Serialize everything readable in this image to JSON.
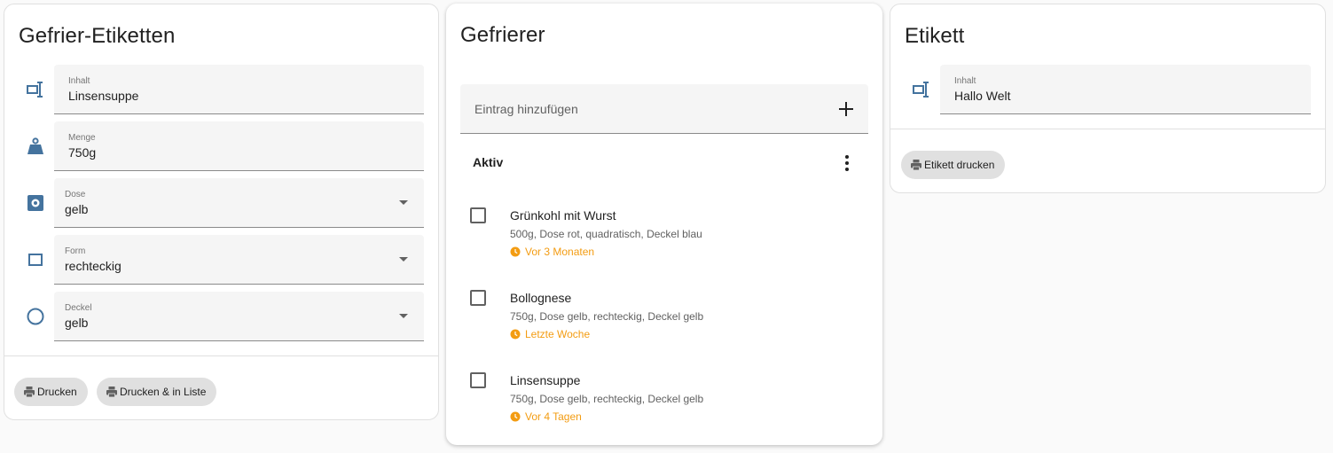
{
  "labels_card": {
    "title": "Gefrier-Etiketten",
    "fields": [
      {
        "label": "Inhalt",
        "value": "Linsensuppe",
        "icon": "label-icon"
      },
      {
        "label": "Menge",
        "value": "750g",
        "icon": "weight-icon"
      },
      {
        "label": "Dose",
        "value": "gelb",
        "icon": "box-icon"
      },
      {
        "label": "Form",
        "value": "rechteckig",
        "icon": "rectangle-icon"
      },
      {
        "label": "Deckel",
        "value": "gelb",
        "icon": "circle-icon"
      }
    ],
    "buttons": {
      "print": "Drucken",
      "print_and_list": "Drucken & in Liste"
    }
  },
  "freezer_card": {
    "title": "Gefrierer",
    "add_placeholder": "Eintrag hinzufügen",
    "section_title": "Aktiv",
    "items": [
      {
        "title": "Grünkohl mit Wurst",
        "details": "500g, Dose rot, quadratisch, Deckel blau",
        "time": "Vor 3 Monaten",
        "checked": false
      },
      {
        "title": "Bollognese",
        "details": "750g, Dose gelb, rechteckig, Deckel gelb",
        "time": "Letzte Woche",
        "checked": false
      },
      {
        "title": "Linsensuppe",
        "details": "750g, Dose gelb, rechteckig, Deckel gelb",
        "time": "Vor 4 Tagen",
        "checked": false
      }
    ]
  },
  "label_card": {
    "title": "Etikett",
    "field": {
      "label": "Inhalt",
      "value": "Hallo Welt",
      "icon": "label-icon"
    },
    "button": "Etikett drucken"
  },
  "colors": {
    "icon": "#44739e",
    "accent_time": "#f39c12",
    "chip_bg": "#e0e0e0",
    "field_bg": "#f5f5f5"
  }
}
